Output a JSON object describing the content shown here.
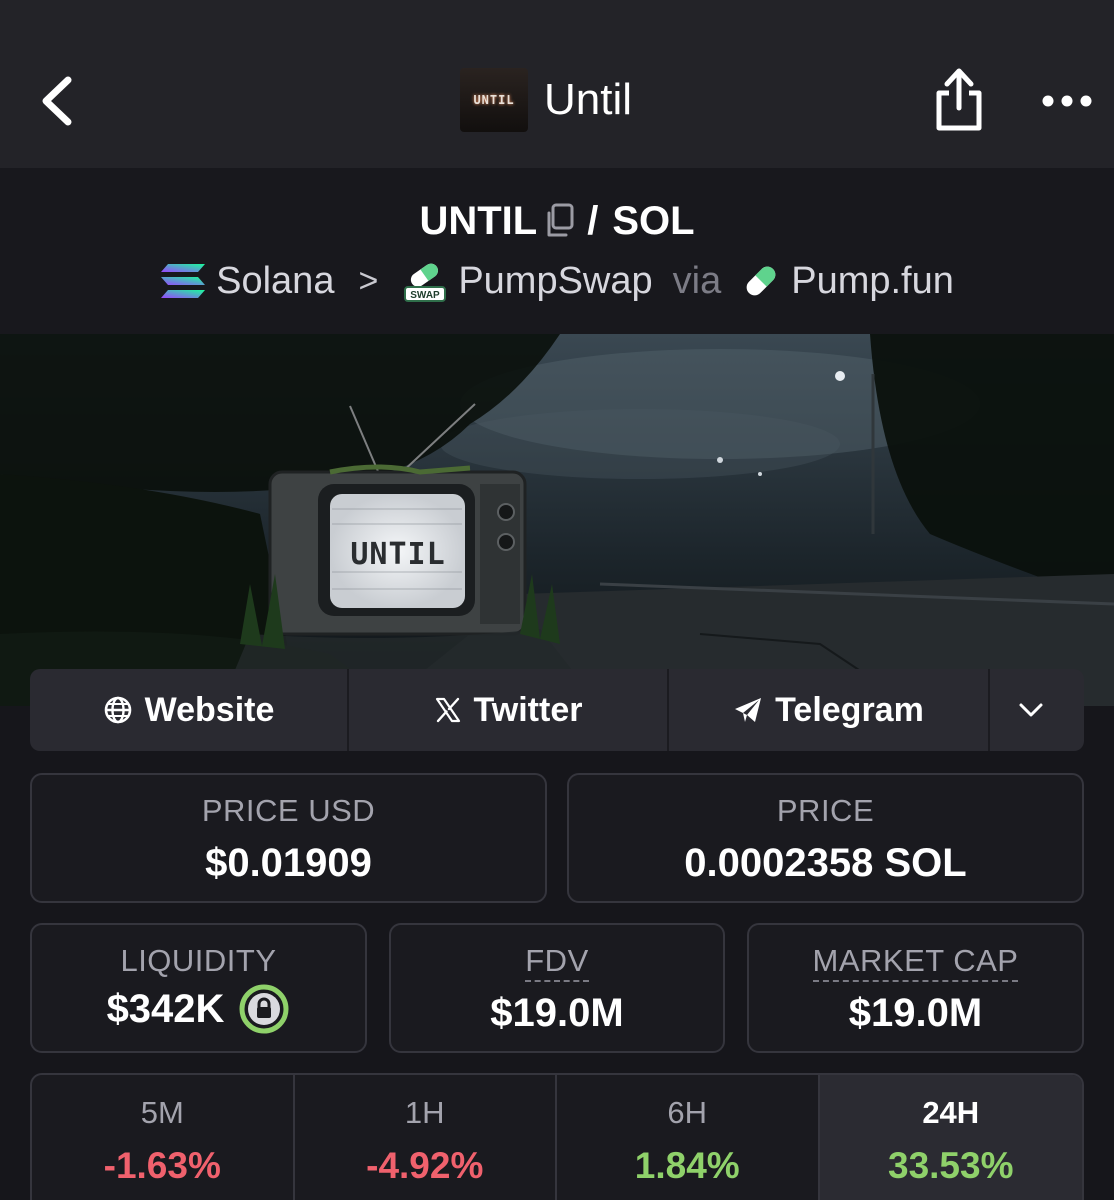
{
  "header": {
    "title": "Until",
    "thumb_text": "UNTIL",
    "back_icon": "chevron-left-icon",
    "share_icon": "share-icon",
    "more_icon": "more-icon"
  },
  "pair": {
    "base": "UNTIL",
    "separator": "/",
    "quote": "SOL",
    "chain": "Solana",
    "dex": "PumpSwap",
    "dex_badge": "SWAP",
    "via": "via",
    "launchpad": "Pump.fun"
  },
  "banner": {
    "tv_text": "UNTIL"
  },
  "links": {
    "website": "Website",
    "twitter": "Twitter",
    "telegram": "Telegram"
  },
  "stats": {
    "price_usd_label": "PRICE USD",
    "price_usd": "$0.01909",
    "price_label": "PRICE",
    "price": "0.0002358 SOL",
    "liquidity_label": "LIQUIDITY",
    "liquidity": "$342K",
    "fdv_label": "FDV",
    "fdv": "$19.0M",
    "mcap_label": "MARKET CAP",
    "mcap": "$19.0M"
  },
  "changes": [
    {
      "label": "5M",
      "value": "-1.63%"
    },
    {
      "label": "1H",
      "value": "-4.92%"
    },
    {
      "label": "6H",
      "value": "1.84%"
    },
    {
      "label": "24H",
      "value": "33.53%"
    }
  ],
  "colors": {
    "negative": "#f0616d",
    "positive": "#8fd16a",
    "lock_ring": "#8fd16a"
  }
}
